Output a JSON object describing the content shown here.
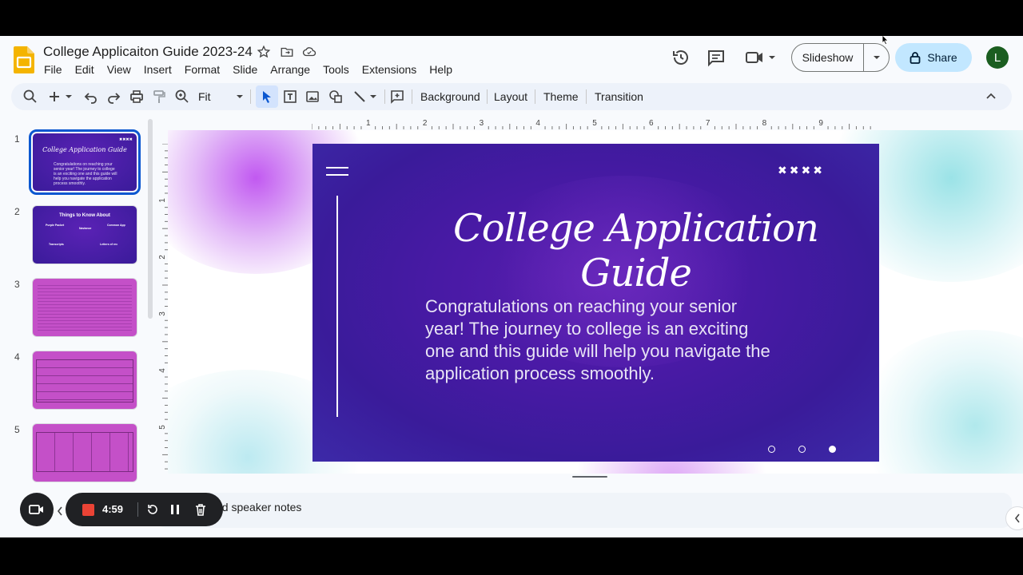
{
  "document": {
    "title": "College Applicaiton Guide 2023-24"
  },
  "menu": [
    "File",
    "Edit",
    "View",
    "Insert",
    "Format",
    "Slide",
    "Arrange",
    "Tools",
    "Extensions",
    "Help"
  ],
  "header": {
    "slideshow_label": "Slideshow",
    "share_label": "Share",
    "avatar_initial": "L"
  },
  "toolbar": {
    "zoom_value": "Fit",
    "background_label": "Background",
    "layout_label": "Layout",
    "theme_label": "Theme",
    "transition_label": "Transition"
  },
  "ruler": {
    "horizontal": [
      "1",
      "2",
      "3",
      "4",
      "5",
      "6",
      "7",
      "8",
      "9"
    ],
    "vertical": [
      "1",
      "2",
      "3",
      "4",
      "5"
    ]
  },
  "filmstrip": {
    "slides": [
      {
        "number": "1",
        "title": "College Application Guide",
        "body": "Congratulations on reaching your senior year! The journey to college is an exciting one and this guide will help you navigate the application process smoothly."
      },
      {
        "number": "2",
        "title": "Things to Know About",
        "labels": [
          "Purple Packet",
          "Naviance",
          "Common App",
          "Transcripts",
          "Letters of rec"
        ]
      },
      {
        "number": "3"
      },
      {
        "number": "4"
      },
      {
        "number": "5"
      }
    ]
  },
  "slide": {
    "title": "College Application Guide",
    "body": "Congratulations on reaching your senior year! The journey to college is an exciting one and this guide will help you navigate the application process smoothly.",
    "decor_x_marks": "✖✖✖✖",
    "colors": {
      "bg": "#4a1aa6",
      "text": "#ffffff"
    }
  },
  "notes": {
    "placeholder": "dd speaker notes"
  },
  "recorder": {
    "time": "4:59",
    "stop_color": "#ea4335"
  }
}
